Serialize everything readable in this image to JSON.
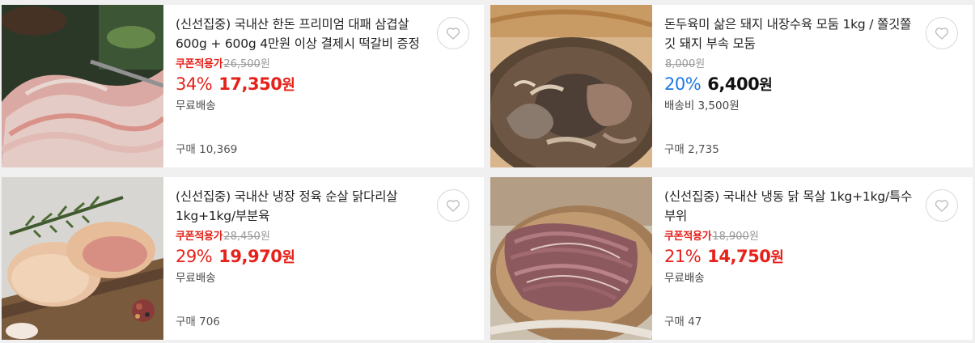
{
  "products": [
    {
      "title": "(신선집중) 국내산 한돈 프리미엄 대패 삼겹살 600g + 600g 4만원 이상 결제시 떡갈비 증정",
      "coupon_label": "쿠폰적용가",
      "original_price": "26,500",
      "original_won": "원",
      "discount_rate": "34%",
      "price": "17,350",
      "won": "원",
      "shipping": "무료배송",
      "purchases": "구매 10,369",
      "image": "pork-belly-photo",
      "favorite_icon": "heart-outline-icon"
    },
    {
      "title": "돈두육미 삶은 돼지 내장수육 모둠 1kg / 쫄깃쫄깃 돼지 부속 모둠",
      "coupon_label": "",
      "original_price": "8,000",
      "original_won": "원",
      "discount_rate": "20%",
      "price": "6,400",
      "won": "원",
      "shipping": "배송비 3,500원",
      "purchases": "구매 2,735",
      "image": "pork-offal-pot-photo",
      "favorite_icon": "heart-outline-icon"
    },
    {
      "title": "(신선집중) 국내산 냉장 정육 순살 닭다리살 1kg+1kg/부분육",
      "coupon_label": "쿠폰적용가",
      "original_price": "28,450",
      "original_won": "원",
      "discount_rate": "29%",
      "price": "19,970",
      "won": "원",
      "shipping": "무료배송",
      "purchases": "구매 706",
      "image": "chicken-thigh-photo",
      "favorite_icon": "heart-outline-icon"
    },
    {
      "title": "(신선집중) 국내산 냉동 닭 목살 1kg+1kg/특수부위",
      "coupon_label": "쿠폰적용가",
      "original_price": "18,900",
      "original_won": "원",
      "discount_rate": "21%",
      "price": "14,750",
      "won": "원",
      "shipping": "무료배송",
      "purchases": "구매 47",
      "image": "chicken-neck-meat-photo",
      "favorite_icon": "heart-outline-icon"
    }
  ],
  "colors": {
    "discount_red": "#e6211a",
    "discount_blue": "#1e7ae6",
    "strike_gray": "#999999",
    "background": "#f0f0f0"
  }
}
